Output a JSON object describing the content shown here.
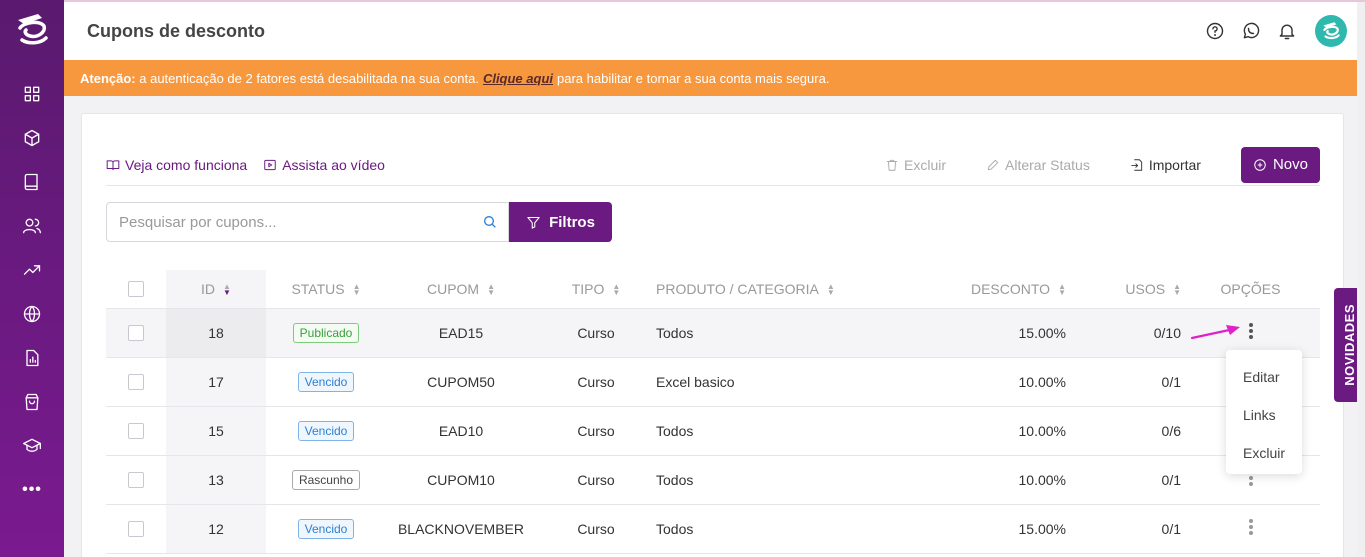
{
  "header": {
    "title": "Cupons de desconto"
  },
  "alert": {
    "label": "Atenção:",
    "text_before": "a autenticação de 2 fatores está desabilitada na sua conta.",
    "link": "Clique aqui",
    "text_after": "para habilitar e tornar a sua conta mais segura."
  },
  "toolbar": {
    "how_it_works": "Veja como funciona",
    "watch_video": "Assista ao vídeo",
    "delete": "Excluir",
    "change_status": "Alterar Status",
    "import": "Importar",
    "new": "Novo"
  },
  "search": {
    "placeholder": "Pesquisar por cupons...",
    "filter_label": "Filtros"
  },
  "table": {
    "columns": {
      "id": "ID",
      "status": "STATUS",
      "coupon": "CUPOM",
      "type": "TIPO",
      "product": "PRODUTO / CATEGORIA",
      "discount": "DESCONTO",
      "uses": "USOS",
      "options": "OPÇÕES"
    },
    "rows": [
      {
        "id": "18",
        "status": "Publicado",
        "coupon": "EAD15",
        "type": "Curso",
        "product": "Todos",
        "discount": "15.00%",
        "uses": "0/10"
      },
      {
        "id": "17",
        "status": "Vencido",
        "coupon": "CUPOM50",
        "type": "Curso",
        "product": "Excel basico",
        "discount": "10.00%",
        "uses": "0/1"
      },
      {
        "id": "15",
        "status": "Vencido",
        "coupon": "EAD10",
        "type": "Curso",
        "product": "Todos",
        "discount": "10.00%",
        "uses": "0/6"
      },
      {
        "id": "13",
        "status": "Rascunho",
        "coupon": "CUPOM10",
        "type": "Curso",
        "product": "Todos",
        "discount": "10.00%",
        "uses": "0/1"
      },
      {
        "id": "12",
        "status": "Vencido",
        "coupon": "BLACKNOVEMBER",
        "type": "Curso",
        "product": "Todos",
        "discount": "15.00%",
        "uses": "0/1"
      }
    ]
  },
  "menu": {
    "items": [
      "Editar",
      "Links",
      "Excluir"
    ]
  },
  "novidades": "NOVIDADES",
  "colors": {
    "brand": "#6b1a82",
    "alert": "#f7983f",
    "published": "#3aa03a",
    "expired": "#2a7fd4",
    "avatar": "#2fb8ad",
    "arrow": "#e020c8"
  },
  "icons": {
    "sidebar": [
      "grid-icon",
      "box-icon",
      "book-icon",
      "users-icon",
      "trending-up-icon",
      "globe-icon",
      "report-icon",
      "shopping-bag-icon",
      "graduation-cap-icon",
      "more-icon"
    ],
    "topbar": [
      "help-icon",
      "whatsapp-icon",
      "bell-icon"
    ]
  }
}
